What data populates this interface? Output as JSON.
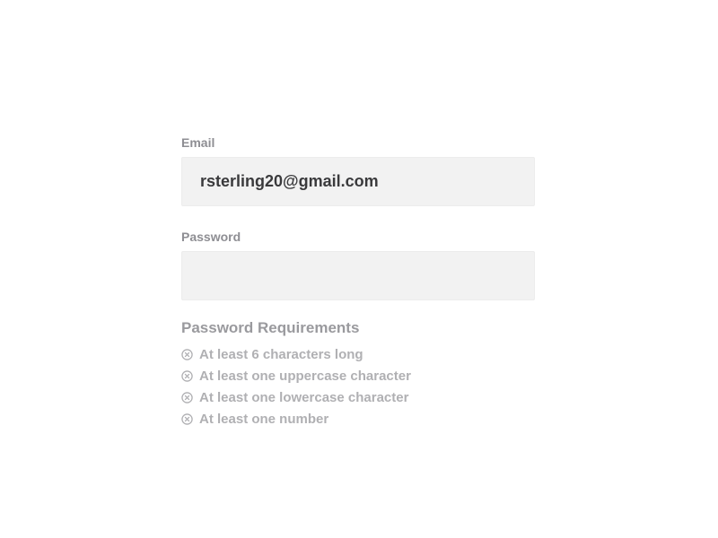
{
  "form": {
    "email": {
      "label": "Email",
      "value": "rsterling20@gmail.com"
    },
    "password": {
      "label": "Password",
      "value": ""
    }
  },
  "requirements": {
    "title": "Password Requirements",
    "icon": "circle-x-icon",
    "items": [
      {
        "label": "At least 6 characters long",
        "met": false
      },
      {
        "label": "At least one uppercase character",
        "met": false
      },
      {
        "label": "At least one lowercase character",
        "met": false
      },
      {
        "label": "At least one number",
        "met": false
      }
    ]
  },
  "colors": {
    "field_bg": "#f2f2f2",
    "label": "#8e8e93",
    "requirement_text": "#b0b0b3"
  }
}
